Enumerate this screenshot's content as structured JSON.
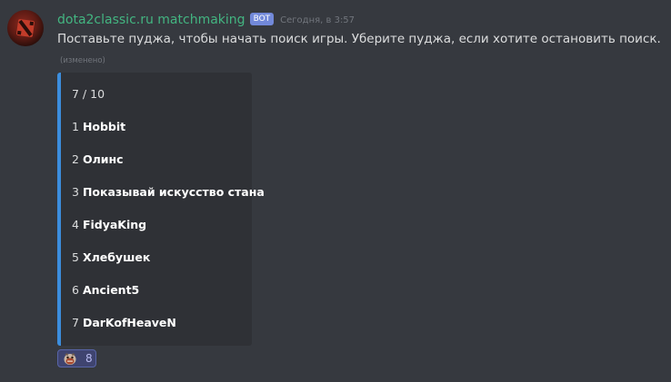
{
  "message": {
    "username": "dota2classic.ru matchmaking",
    "bot_tag": "BOT",
    "timestamp": "Сегодня, в 3:57",
    "content": "Поставьте пуджа, чтобы начать поиск игры. Уберите пуджа, если хотите остановить поиск.",
    "edited": "(изменено)"
  },
  "embed": {
    "count": "7 / 10",
    "players": [
      {
        "num": "1",
        "name": "Hobbit"
      },
      {
        "num": "2",
        "name": "Олинс"
      },
      {
        "num": "3",
        "name": "Показывай искусство стана"
      },
      {
        "num": "4",
        "name": "FidyaKing"
      },
      {
        "num": "5",
        "name": "Хлебушек"
      },
      {
        "num": "6",
        "name": "Ancient5"
      },
      {
        "num": "7",
        "name": "DarKofHeaveN"
      }
    ],
    "accent_color": "#3c8ede"
  },
  "reaction": {
    "emoji": "pudge-emoji",
    "count": "8"
  },
  "colors": {
    "background": "#36393f",
    "username": "#43b581",
    "bot_tag": "#7289da",
    "embed_bg": "#2f3136"
  }
}
